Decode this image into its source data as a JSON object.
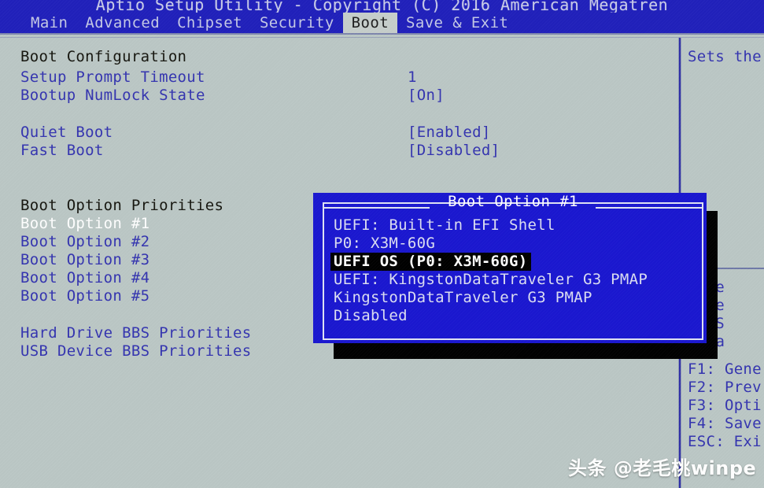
{
  "window": {
    "title": "Aptio Setup Utility - Copyright (C) 2016 American Megatren",
    "header_color": "#2020bb",
    "background_color": "#bbc7c5",
    "text_color": "#3434b0"
  },
  "menubar": {
    "tabs": [
      {
        "label": "Main",
        "active": false
      },
      {
        "label": "Advanced",
        "active": false
      },
      {
        "label": "Chipset",
        "active": false
      },
      {
        "label": "Security",
        "active": false
      },
      {
        "label": "Boot",
        "active": true
      },
      {
        "label": "Save & Exit",
        "active": false
      }
    ]
  },
  "settings": {
    "section_boot_configuration": "Boot Configuration",
    "items": [
      {
        "label": "Setup Prompt Timeout",
        "value": "1",
        "highlighted": false
      },
      {
        "label": "Bootup NumLock State",
        "value": "[On]",
        "highlighted": false
      },
      {
        "label": "Quiet Boot",
        "value": "[Enabled]",
        "highlighted": false
      },
      {
        "label": "Fast Boot",
        "value": "[Disabled]",
        "highlighted": false
      }
    ],
    "section_boot_option_priorities": "Boot Option Priorities",
    "boot_options": [
      {
        "label": "Boot Option #1",
        "highlighted": true
      },
      {
        "label": "Boot Option #2",
        "highlighted": false
      },
      {
        "label": "Boot Option #3",
        "highlighted": false
      },
      {
        "label": "Boot Option #4",
        "highlighted": false
      },
      {
        "label": "Boot Option #5",
        "highlighted": false
      }
    ],
    "submenus": [
      {
        "label": "Hard Drive BBS Priorities"
      },
      {
        "label": "USB Device BBS Priorities"
      }
    ]
  },
  "help_pane": {
    "description": "Sets the",
    "nav_lines": [
      "Sele",
      "Sele",
      "r: S",
      "Cha"
    ],
    "key_lines": [
      "F1: Gene",
      "F2: Prev",
      "F3: Opti",
      "F4: Save",
      "ESC: Exi"
    ]
  },
  "popup": {
    "title": "Boot Option #1",
    "background_color": "#1a17d0",
    "border_color": "#dfe2f4",
    "selected_color": "#000000",
    "options": [
      {
        "label": "UEFI: Built-in EFI Shell",
        "selected": false
      },
      {
        "label": "P0: X3M-60G",
        "selected": false
      },
      {
        "label": "UEFI OS (P0: X3M-60G)",
        "selected": true
      },
      {
        "label": "UEFI: KingstonDataTraveler G3 PMAP",
        "selected": false
      },
      {
        "label": "KingstonDataTraveler G3 PMAP",
        "selected": false
      },
      {
        "label": "Disabled",
        "selected": false
      }
    ]
  },
  "watermark": {
    "text": "头条 @老毛桃winpe"
  }
}
